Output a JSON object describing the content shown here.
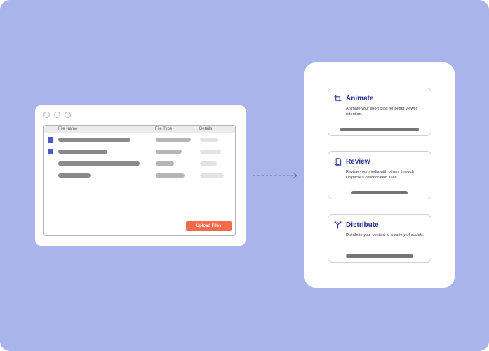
{
  "window": {
    "columns": [
      "",
      "File Name",
      "File Type",
      "Details"
    ],
    "rows": [
      {
        "checked": true
      },
      {
        "checked": true
      },
      {
        "checked": false
      },
      {
        "checked": false
      }
    ],
    "upload_label": "Upload Files"
  },
  "features": [
    {
      "title": "Animate",
      "icon": "crop-icon",
      "description": "Animate your short clips for better viewer retention."
    },
    {
      "title": "Review",
      "icon": "copy-icon",
      "description": "Review your media with others through Disperse's collaboration suite."
    },
    {
      "title": "Distribute",
      "icon": "split-arrows-icon",
      "description": "Distribute your content to a variety of socials."
    }
  ],
  "colors": {
    "background": "#a9b4ea",
    "accent": "#4a59c6",
    "button": "#f46a4a",
    "title": "#2b3596"
  }
}
